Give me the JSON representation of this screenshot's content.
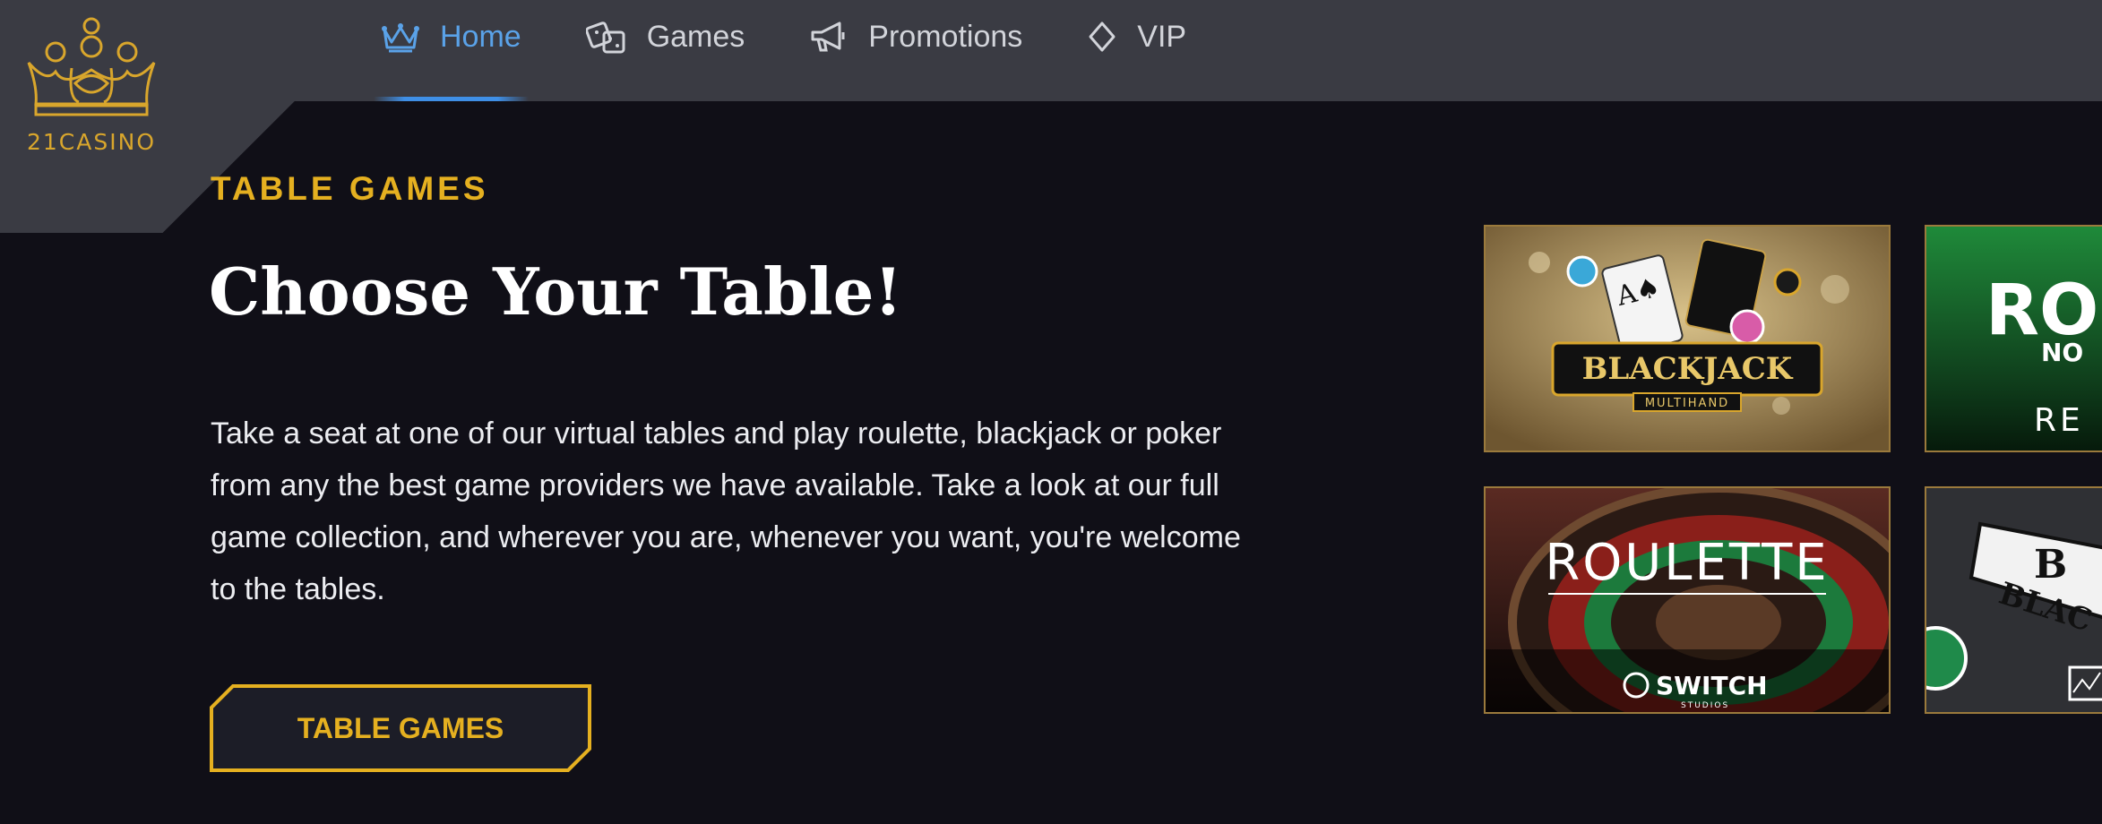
{
  "brand": {
    "name": "21CASINO",
    "logo_icon": "crown-logo-icon"
  },
  "nav": {
    "items": [
      {
        "label": "Home",
        "icon": "crown-icon",
        "active": true
      },
      {
        "label": "Games",
        "icon": "dice-icon",
        "active": false
      },
      {
        "label": "Promotions",
        "icon": "megaphone-icon",
        "active": false
      },
      {
        "label": "VIP",
        "icon": "diamond-icon",
        "active": false
      }
    ]
  },
  "hero": {
    "eyebrow": "TABLE GAMES",
    "heading": "Choose Your Table!",
    "body": "Take a seat at one of our virtual tables and play roulette, blackjack or poker from any the best game providers we have available. Take a look at our full game collection, and wherever you are, whenever you want, you're welcome to the tables.",
    "cta_label": "TABLE GAMES"
  },
  "game_tiles": [
    {
      "title": "BLACKJACK",
      "subtitle": "MULTIHAND"
    },
    {
      "title": "ROU",
      "subtitle": "NO",
      "provider": "RE"
    },
    {
      "title": "ROULETTE",
      "provider": "SWITCH",
      "provider_sub": "STUDIOS"
    },
    {
      "title": "B",
      "subtitle": "BLAC"
    }
  ],
  "colors": {
    "accent_gold": "#e5b020",
    "nav_active": "#5aa2e8",
    "background": "#100f17",
    "topbar": "#3a3b43"
  }
}
